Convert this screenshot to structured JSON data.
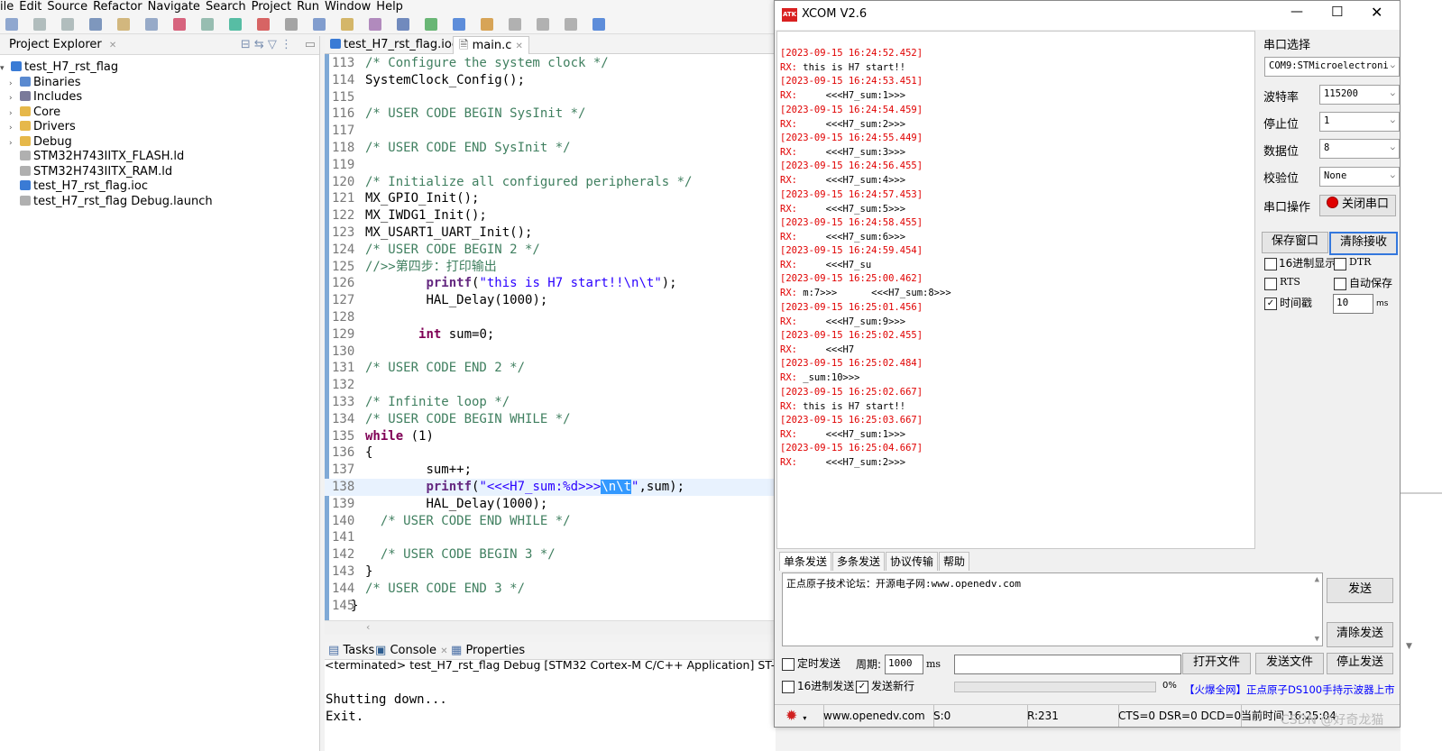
{
  "eclipse": {
    "menu": [
      "ile",
      "Edit",
      "Source",
      "Refactor",
      "Navigate",
      "Search",
      "Project",
      "Run",
      "Window",
      "Help"
    ],
    "project_explorer": {
      "tab_label": "Project Explorer",
      "tree": [
        {
          "label": "test_H7_rst_flag",
          "indent": 0,
          "twisty": "▾",
          "icon": "project-icon"
        },
        {
          "label": "Binaries",
          "indent": 1,
          "twisty": "›",
          "icon": "binaries-icon"
        },
        {
          "label": "Includes",
          "indent": 1,
          "twisty": "›",
          "icon": "includes-icon"
        },
        {
          "label": "Core",
          "indent": 1,
          "twisty": "›",
          "icon": "folder-icon"
        },
        {
          "label": "Drivers",
          "indent": 1,
          "twisty": "›",
          "icon": "folder-icon"
        },
        {
          "label": "Debug",
          "indent": 1,
          "twisty": "›",
          "icon": "folder-icon"
        },
        {
          "label": "STM32H743IITX_FLASH.ld",
          "indent": 1,
          "twisty": "",
          "icon": "file-icon"
        },
        {
          "label": "STM32H743IITX_RAM.ld",
          "indent": 1,
          "twisty": "",
          "icon": "file-icon"
        },
        {
          "label": "test_H7_rst_flag.ioc",
          "indent": 1,
          "twisty": "",
          "icon": "ioc-icon"
        },
        {
          "label": "test_H7_rst_flag Debug.launch",
          "indent": 1,
          "twisty": "",
          "icon": "file-icon"
        }
      ]
    },
    "editor_tabs": [
      "test_H7_rst_flag.ioc",
      "main.c"
    ],
    "code_lines": [
      {
        "n": "113",
        "indent": "",
        "parts": [
          {
            "t": "/* Configure the system clock */",
            "c": "cm"
          }
        ]
      },
      {
        "n": "114",
        "indent": "",
        "parts": [
          {
            "t": "SystemClock_Config();",
            "c": ""
          }
        ]
      },
      {
        "n": "115",
        "indent": "",
        "parts": []
      },
      {
        "n": "116",
        "indent": "",
        "parts": [
          {
            "t": "/* USER CODE BEGIN SysInit */",
            "c": "cm"
          }
        ]
      },
      {
        "n": "117",
        "indent": "",
        "parts": []
      },
      {
        "n": "118",
        "indent": "",
        "parts": [
          {
            "t": "/* USER CODE END SysInit */",
            "c": "cm"
          }
        ]
      },
      {
        "n": "119",
        "indent": "",
        "parts": []
      },
      {
        "n": "120",
        "indent": "",
        "parts": [
          {
            "t": "/* Initialize all configured peripherals */",
            "c": "cm"
          }
        ]
      },
      {
        "n": "121",
        "indent": "",
        "parts": [
          {
            "t": "MX_GPIO_Init();",
            "c": ""
          }
        ]
      },
      {
        "n": "122",
        "indent": "",
        "parts": [
          {
            "t": "MX_IWDG1_Init();",
            "c": ""
          }
        ]
      },
      {
        "n": "123",
        "indent": "",
        "parts": [
          {
            "t": "MX_USART1_UART_Init();",
            "c": ""
          }
        ]
      },
      {
        "n": "124",
        "indent": "",
        "parts": [
          {
            "t": "/* USER CODE BEGIN 2 */",
            "c": "cm"
          }
        ]
      },
      {
        "n": "125",
        "indent": "",
        "parts": [
          {
            "t": "//>>第四步：打印输出",
            "c": "cm"
          }
        ]
      },
      {
        "n": "126",
        "indent": "        ",
        "parts": [
          {
            "t": "printf",
            "c": "fn"
          },
          {
            "t": "(",
            "c": ""
          },
          {
            "t": "\"this is H7 start!!\\n\\t\"",
            "c": "st"
          },
          {
            "t": ");",
            "c": ""
          }
        ]
      },
      {
        "n": "127",
        "indent": "        ",
        "parts": [
          {
            "t": "HAL_Delay(1000);",
            "c": ""
          }
        ]
      },
      {
        "n": "128",
        "indent": "",
        "parts": []
      },
      {
        "n": "129",
        "indent": "       ",
        "parts": [
          {
            "t": "int",
            "c": "kw"
          },
          {
            "t": " sum=0;",
            "c": ""
          }
        ]
      },
      {
        "n": "130",
        "indent": "",
        "parts": []
      },
      {
        "n": "131",
        "indent": "",
        "parts": [
          {
            "t": "/* USER CODE END 2 */",
            "c": "cm"
          }
        ]
      },
      {
        "n": "132",
        "indent": "",
        "parts": []
      },
      {
        "n": "133",
        "indent": "",
        "parts": [
          {
            "t": "/* Infinite loop */",
            "c": "cm"
          }
        ]
      },
      {
        "n": "134",
        "indent": "",
        "parts": [
          {
            "t": "/* USER CODE BEGIN WHILE */",
            "c": "cm"
          }
        ]
      },
      {
        "n": "135",
        "indent": "",
        "parts": [
          {
            "t": "while",
            "c": "kw"
          },
          {
            "t": " (1)",
            "c": ""
          }
        ]
      },
      {
        "n": "136",
        "indent": "",
        "parts": [
          {
            "t": "{",
            "c": ""
          }
        ]
      },
      {
        "n": "137",
        "indent": "        ",
        "parts": [
          {
            "t": "sum++;",
            "c": ""
          }
        ]
      },
      {
        "n": "138",
        "indent": "        ",
        "parts": [
          {
            "t": "printf",
            "c": "fn"
          },
          {
            "t": "(",
            "c": ""
          },
          {
            "t": "\"<<<H7_sum:%d>>>",
            "c": "st"
          },
          {
            "t": "\\n\\t",
            "c": "sel"
          },
          {
            "t": "\"",
            "c": "st"
          },
          {
            "t": ",sum);",
            "c": ""
          }
        ]
      },
      {
        "n": "139",
        "indent": "        ",
        "parts": [
          {
            "t": "HAL_Delay(1000);",
            "c": ""
          }
        ]
      },
      {
        "n": "140",
        "indent": "  ",
        "parts": [
          {
            "t": "/* USER CODE END WHILE */",
            "c": "cm"
          }
        ]
      },
      {
        "n": "141",
        "indent": "",
        "parts": []
      },
      {
        "n": "142",
        "indent": "  ",
        "parts": [
          {
            "t": "/* USER CODE BEGIN 3 */",
            "c": "cm"
          }
        ]
      },
      {
        "n": "143",
        "indent": "",
        "parts": [
          {
            "t": "}",
            "c": ""
          }
        ]
      },
      {
        "n": "144",
        "indent": "",
        "parts": [
          {
            "t": "/* USER CODE END 3 */",
            "c": "cm"
          }
        ]
      },
      {
        "n": "145",
        "indent": "-",
        "parts": [
          {
            "t": "}",
            "c": ""
          }
        ]
      }
    ],
    "console": {
      "tabs": [
        "Tasks",
        "Console",
        "Properties"
      ],
      "header": "<terminated> test_H7_rst_flag Debug [STM32 Cortex-M C/C++ Application] ST-LINK (ST-",
      "lines": [
        "Shutting down...",
        "Exit."
      ]
    }
  },
  "xcom": {
    "title": "XCOM V2.6",
    "logo_text": "ATK",
    "receive_lines": [
      {
        "ts": "[2023-09-15 16:24:52.452]",
        "rx": "RX:",
        "msg": " this is H7 start!!"
      },
      {
        "ts": "[2023-09-15 16:24:53.451]",
        "rx": "RX:",
        "msg": "     <<<H7_sum:1>>>"
      },
      {
        "ts": "[2023-09-15 16:24:54.459]",
        "rx": "RX:",
        "msg": "     <<<H7_sum:2>>>"
      },
      {
        "ts": "[2023-09-15 16:24:55.449]",
        "rx": "RX:",
        "msg": "     <<<H7_sum:3>>>"
      },
      {
        "ts": "[2023-09-15 16:24:56.455]",
        "rx": "RX:",
        "msg": "     <<<H7_sum:4>>>"
      },
      {
        "ts": "[2023-09-15 16:24:57.453]",
        "rx": "RX:",
        "msg": "     <<<H7_sum:5>>>"
      },
      {
        "ts": "[2023-09-15 16:24:58.455]",
        "rx": "RX:",
        "msg": "     <<<H7_sum:6>>>"
      },
      {
        "ts": "[2023-09-15 16:24:59.454]",
        "rx": "RX:",
        "msg": "     <<<H7_su"
      },
      {
        "ts": "[2023-09-15 16:25:00.462]",
        "rx": "RX:",
        "msg": " m:7>>>      <<<H7_sum:8>>>"
      },
      {
        "ts": "[2023-09-15 16:25:01.456]",
        "rx": "RX:",
        "msg": "     <<<H7_sum:9>>>"
      },
      {
        "ts": "[2023-09-15 16:25:02.455]",
        "rx": "RX:",
        "msg": "     <<<H7"
      },
      {
        "ts": "[2023-09-15 16:25:02.484]",
        "rx": "RX:",
        "msg": " _sum:10>>>"
      },
      {
        "ts": "[2023-09-15 16:25:02.667]",
        "rx": "RX:",
        "msg": " this is H7 start!!"
      },
      {
        "ts": "[2023-09-15 16:25:03.667]",
        "rx": "RX:",
        "msg": "     <<<H7_sum:1>>>"
      },
      {
        "ts": "[2023-09-15 16:25:04.667]",
        "rx": "RX:",
        "msg": "     <<<H7_sum:2>>>"
      }
    ],
    "settings": {
      "port_label": "串口选择",
      "port_value": "COM9:STMicroelectroni",
      "baud_label": "波特率",
      "baud_value": "115200",
      "stop_label": "停止位",
      "stop_value": "1",
      "data_label": "数据位",
      "data_value": "8",
      "parity_label": "校验位",
      "parity_value": "None",
      "op_label": "串口操作",
      "close_port_button": "关闭串口",
      "save_window_button": "保存窗口",
      "clear_receive_button": "清除接收",
      "hex_display": "16进制显示",
      "dtr": "DTR",
      "rts": "RTS",
      "auto_save": "自动保存",
      "timestamp": "时间戳",
      "timestamp_value": "10",
      "timestamp_unit": "ms"
    },
    "send_tabs": [
      "单条发送",
      "多条发送",
      "协议传输",
      "帮助"
    ],
    "send_text": "正点原子技术论坛：开源电子网:www.openedv.com",
    "send_button": "发送",
    "clear_send_button": "清除发送",
    "timed_send": "定时发送",
    "period_label": "周期:",
    "period_value": "1000",
    "period_unit": "ms",
    "open_file_button": "打开文件",
    "send_file_button": "发送文件",
    "stop_send_button": "停止发送",
    "hex_send": "16进制发送",
    "send_newline": "发送新行",
    "progress_text": "0%",
    "ad_text": "【火爆全网】正点原子DS100手持示波器上市",
    "status": {
      "website": "www.openedv.com",
      "sent": "S:0",
      "received": "R:231",
      "lines": "CTS=0 DSR=0 DCD=0",
      "time": "当前时间 16:25:04"
    }
  },
  "watermark": "CSDN @好奇龙猫",
  "colors": {
    "timestamp": "#e00000",
    "gutter": "#7fa9d6",
    "selection": "#3399ff",
    "ad_link": "#0000ff"
  }
}
